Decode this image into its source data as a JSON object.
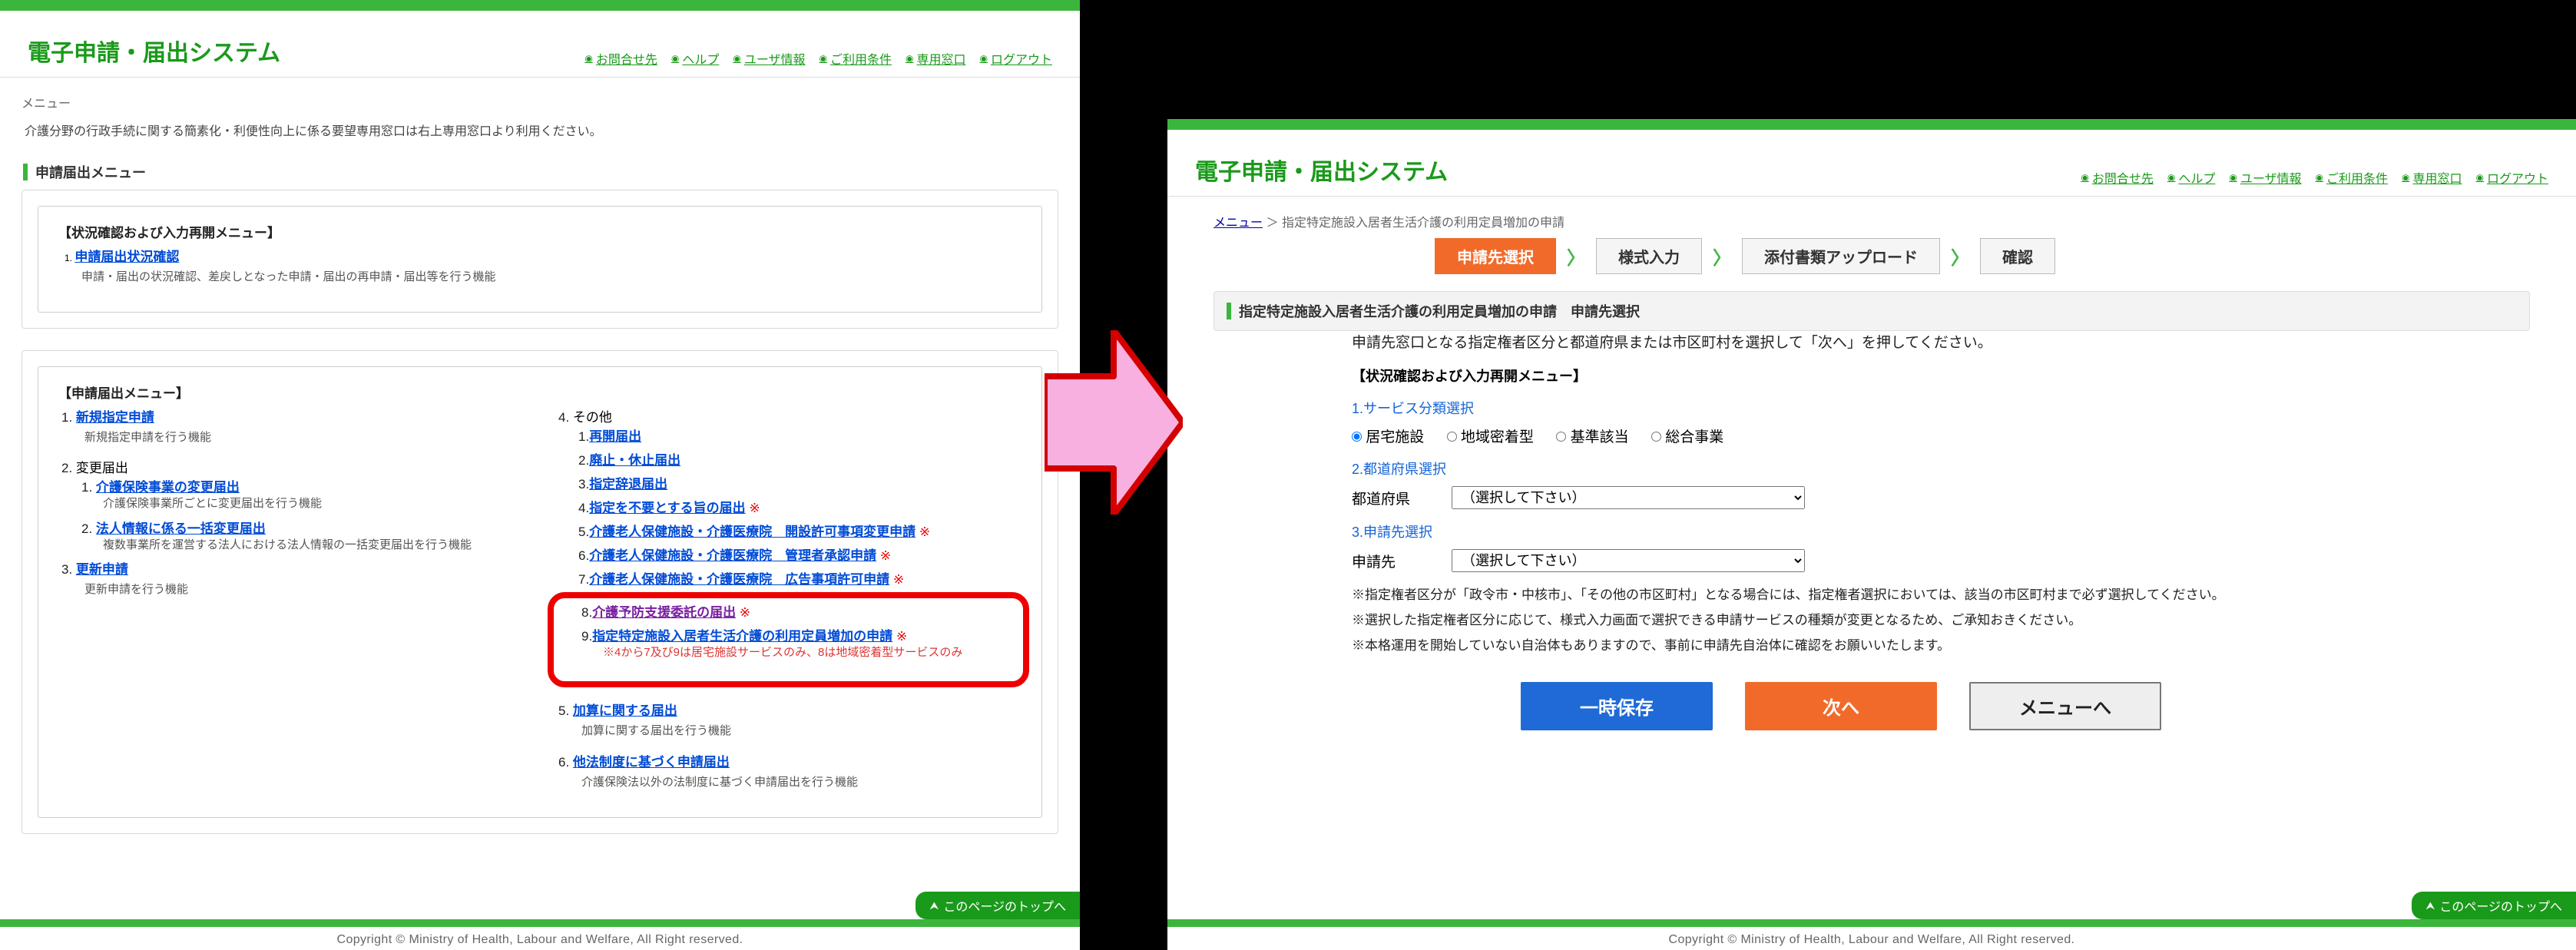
{
  "header": {
    "site_title": "電子申請・届出システム",
    "links": {
      "contact": "お問合せ先",
      "help": "ヘルプ",
      "user_info": "ユーザ情報",
      "terms": "ご利用条件",
      "special": "専用窓口",
      "logout": "ログアウト"
    }
  },
  "left": {
    "breadcrumb": "メニュー",
    "intro": "介護分野の行政手続に関する簡素化・利便性向上に係る要望専用窓口は右上専用窓口より利用ください。",
    "section_title": "申請届出メニュー",
    "confirm_menu": {
      "title": "【状況確認および入力再開メニュー】",
      "item1_idx": "1.",
      "item1_label": "申請届出状況確認",
      "item1_desc": "申請・届出の状況確認、差戻しとなった申請・届出の再申請・届出等を行う機能"
    },
    "appl_menu": {
      "title": "【申請届出メニュー】",
      "g1": {
        "idx": "1.",
        "label": "新規指定申請",
        "desc": "新規指定申請を行う機能"
      },
      "g2": {
        "idx": "2.",
        "label": "変更届出",
        "s1": {
          "idx": "1.",
          "label": "介護保険事業の変更届出",
          "desc": "介護保険事業所ごとに変更届出を行う機能"
        },
        "s2": {
          "idx": "2.",
          "label": "法人情報に係る一括変更届出",
          "desc": "複数事業所を運営する法人における法人情報の一括変更届出を行う機能"
        }
      },
      "g3": {
        "idx": "3.",
        "label": "更新申請",
        "desc": "更新申請を行う機能"
      },
      "g4": {
        "idx": "4.",
        "label": "その他",
        "s1": {
          "idx": "1.",
          "label": "再開届出"
        },
        "s2": {
          "idx": "2.",
          "label": "廃止・休止届出"
        },
        "s3": {
          "idx": "3.",
          "label": "指定辞退届出"
        },
        "s4": {
          "idx": "4.",
          "label": "指定を不要とする旨の届出",
          "star": "※"
        },
        "s5": {
          "idx": "5.",
          "label": "介護老人保健施設・介護医療院　開設許可事項変更申請",
          "star": "※"
        },
        "s6": {
          "idx": "6.",
          "label": "介護老人保健施設・介護医療院　管理者承認申請",
          "star": "※"
        },
        "s7": {
          "idx": "7.",
          "label": "介護老人保健施設・介護医療院　広告事項許可申請",
          "star": "※"
        },
        "s8": {
          "idx": "8.",
          "label": "介護予防支援委託の届出",
          "star": "※"
        },
        "s9": {
          "idx": "9.",
          "label": "指定特定施設入居者生活介護の利用定員増加の申請",
          "star": "※",
          "desc": "※4から7及び9は居宅施設サービスのみ、8は地域密着型サービスのみ"
        }
      },
      "g5": {
        "idx": "5.",
        "label": "加算に関する届出",
        "desc": "加算に関する届出を行う機能"
      },
      "g6": {
        "idx": "6.",
        "label": "他法制度に基づく申請届出",
        "desc": "介護保険法以外の法制度に基づく申請届出を行う機能"
      }
    }
  },
  "right": {
    "breadcrumb_link": "メニュー",
    "breadcrumb_sep": "＞",
    "breadcrumb_cur": "指定特定施設入居者生活介護の利用定員増加の申請",
    "wizard": {
      "s1": "申請先選択",
      "s2": "様式入力",
      "s3": "添付書類アップロード",
      "s4": "確認"
    },
    "page_title": "指定特定施設入居者生活介護の利用定員増加の申請　申請先選択",
    "form": {
      "lead": "申請先窓口となる指定権者区分と都道府県または市区町村を選択して「次へ」を押してください。",
      "confirm_title": "【状況確認および入力再開メニュー】",
      "step1_label": "1.サービス分類選択",
      "radios": {
        "r1": "居宅施設",
        "r2": "地域密着型",
        "r3": "基準該当",
        "r4": "総合事業"
      },
      "step2_label": "2.都道府県選択",
      "pref_lbl": "都道府県",
      "placeholder": "（選択して下さい）",
      "step3_label": "3.申請先選択",
      "dest_lbl": "申請先",
      "notes": {
        "n1": "※指定権者区分が「政令市・中核市」、「その他の市区町村」となる場合には、指定権者選択においては、該当の市区町村まで必ず選択してください。",
        "n2": "※選択した指定権者区分に応じて、様式入力画面で選択できる申請サービスの種類が変更となるため、ご承知おきください。",
        "n3": "※本格運用を開始していない自治体もありますので、事前に申請先自治体に確認をお願いいたします。"
      },
      "buttons": {
        "save": "一時保存",
        "next": "次へ",
        "menu": "メニューへ"
      }
    }
  },
  "common": {
    "page_top": "このページのトップへ",
    "copyright": "Copyright © Ministry of Health, Labour and Welfare, All Right reserved."
  }
}
